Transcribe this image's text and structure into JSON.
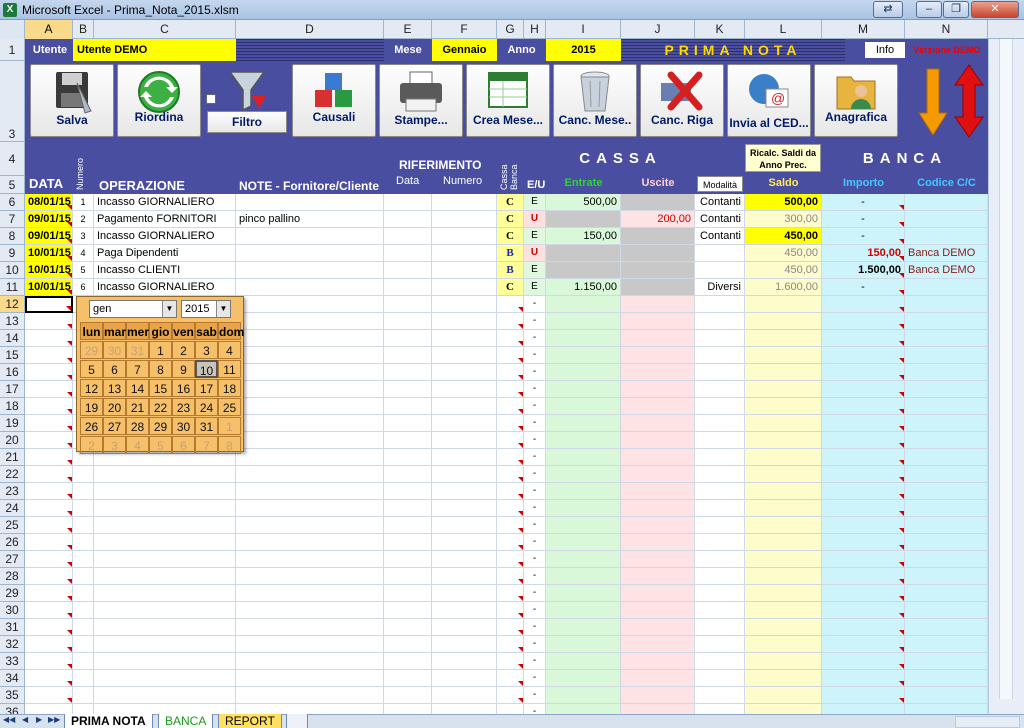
{
  "window": {
    "title": "Microsoft Excel - Prima_Nota_2015.xlsm",
    "excel_icon": "X",
    "buttons": [
      "⇄",
      "‒",
      "❒",
      "✕"
    ]
  },
  "columns": [
    "A",
    "B",
    "C",
    "D",
    "E",
    "F",
    "G",
    "H",
    "I",
    "J",
    "K",
    "L",
    "M",
    "N"
  ],
  "header_band": {
    "utente_label": "Utente",
    "utente_value": "Utente DEMO",
    "mese_label": "Mese",
    "mese_value": "Gennaio",
    "anno_label": "Anno",
    "anno_value": "2015",
    "title": "PRIMA NOTA",
    "info": "Info",
    "version": "Versione DEMO"
  },
  "toolbar": [
    "Salva",
    "Riordina",
    "Filtro",
    "Causali",
    "Stampe...",
    "Crea Mese...",
    "Canc. Mese..",
    "Canc. Riga",
    "Invia al CED...",
    "Anagrafica"
  ],
  "headers": {
    "data": "DATA",
    "numero": "Numero",
    "operazione": "OPERAZIONE",
    "note": "NOTE - Fornitore/Cliente",
    "riferimento": "RIFERIMENTO",
    "rif_data": "Data",
    "rif_numero": "Numero",
    "cassa_banca": "Cassa Banca",
    "eu": "E/U",
    "cassa": "CASSA",
    "entrate": "Entrate",
    "uscite": "Uscite",
    "modalita": "Modalità",
    "ricalc": "Ricalc. Saldi da Anno Prec.",
    "saldo": "Saldo",
    "banca": "BANCA",
    "importo": "Importo",
    "codice": "Codice C/C"
  },
  "rows": [
    {
      "data": "08/01/15",
      "num": "1",
      "op": "Incasso GIORNALIERO",
      "note": "",
      "cb": "C",
      "eu": "E",
      "entrate": "500,00",
      "uscite": "",
      "mod": "Contanti",
      "saldo": "500,00",
      "importo": "-",
      "codice": ""
    },
    {
      "data": "09/01/15",
      "num": "2",
      "op": "Pagamento FORNITORI",
      "note": "pinco pallino",
      "cb": "C",
      "eu": "U",
      "entrate": "",
      "uscite": "200,00",
      "mod": "Contanti",
      "saldo": "300,00",
      "importo": "-",
      "codice": ""
    },
    {
      "data": "09/01/15",
      "num": "3",
      "op": "Incasso GIORNALIERO",
      "note": "",
      "cb": "C",
      "eu": "E",
      "entrate": "150,00",
      "uscite": "",
      "mod": "Contanti",
      "saldo": "450,00",
      "importo": "-",
      "codice": ""
    },
    {
      "data": "10/01/15",
      "num": "4",
      "op": "Paga Dipendenti",
      "note": "",
      "cb": "B",
      "eu": "U",
      "entrate": "",
      "uscite": "",
      "mod": "",
      "saldo": "450,00",
      "importo": "150,00",
      "codice": "Banca DEMO"
    },
    {
      "data": "10/01/15",
      "num": "5",
      "op": "Incasso CLIENTI",
      "note": "",
      "cb": "B",
      "eu": "E",
      "entrate": "",
      "uscite": "",
      "mod": "",
      "saldo": "450,00",
      "importo": "1.500,00",
      "codice": "Banca DEMO"
    },
    {
      "data": "10/01/15",
      "num": "6",
      "op": "Incasso GIORNALIERO",
      "note": "",
      "cb": "C",
      "eu": "E",
      "entrate": "1.150,00",
      "uscite": "",
      "mod": "Diversi",
      "saldo": "1.600,00",
      "importo": "-",
      "codice": ""
    }
  ],
  "empty_dash": "-",
  "calendar": {
    "month": "gen",
    "year": "2015",
    "arrow": "▼",
    "days": [
      "lun",
      "mar",
      "mer",
      "gio",
      "ven",
      "sab",
      "dom"
    ],
    "weeks": [
      [
        "29",
        "30",
        "31",
        "1",
        "2",
        "3",
        "4"
      ],
      [
        "5",
        "6",
        "7",
        "8",
        "9",
        "10",
        "11"
      ],
      [
        "12",
        "13",
        "14",
        "15",
        "16",
        "17",
        "18"
      ],
      [
        "19",
        "20",
        "21",
        "22",
        "23",
        "24",
        "25"
      ],
      [
        "26",
        "27",
        "28",
        "29",
        "30",
        "31",
        "1"
      ],
      [
        "2",
        "3",
        "4",
        "5",
        "6",
        "7",
        "8"
      ]
    ]
  },
  "tabs": [
    "PRIMA NOTA",
    "BANCA",
    "REPORT"
  ],
  "tab_nav": [
    "◀◀",
    "◀",
    "▶",
    "▶▶"
  ]
}
